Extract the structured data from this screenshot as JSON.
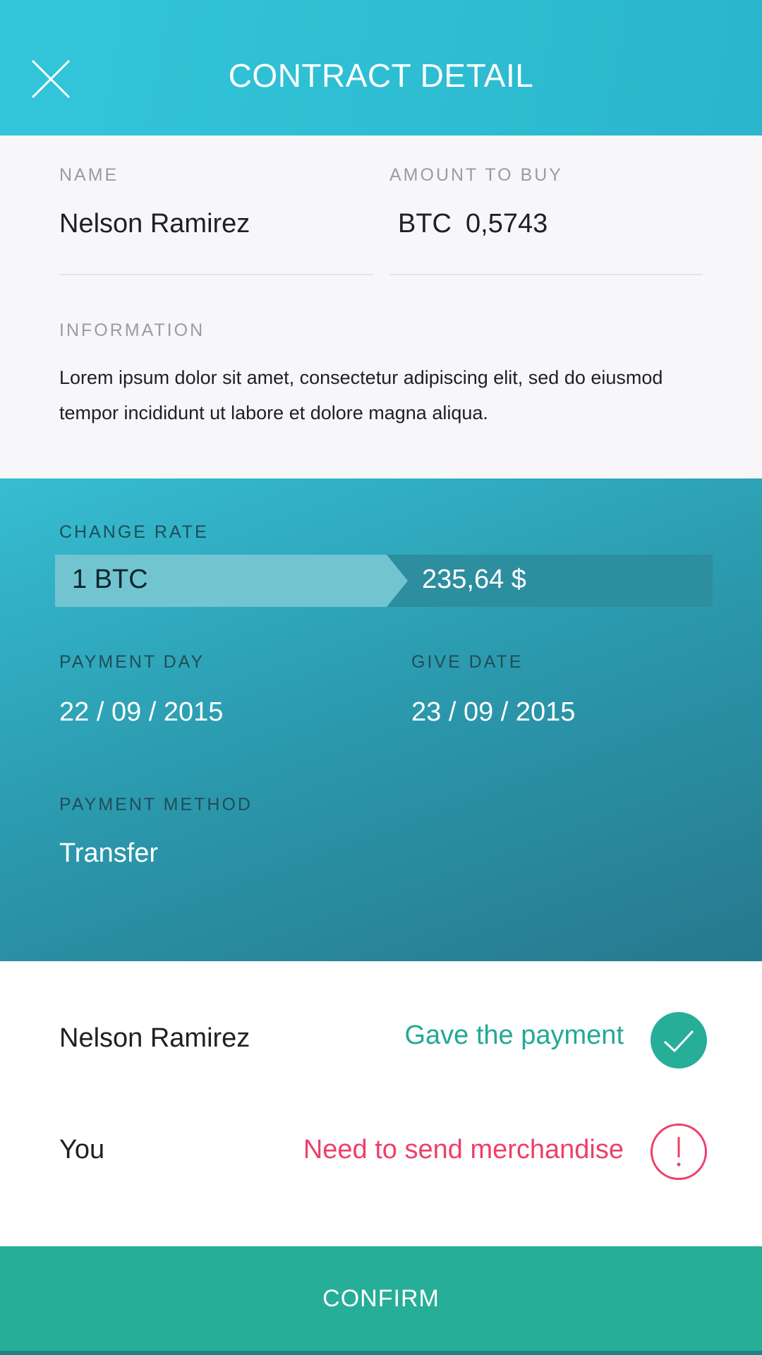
{
  "header": {
    "title": "CONTRACT DETAIL",
    "close_icon": "close-icon"
  },
  "details": {
    "name_label": "NAME",
    "name_value": "Nelson Ramirez",
    "amount_label": "AMOUNT TO BUY",
    "amount_currency": "BTC",
    "amount_value": "0,5743",
    "info_label": "INFORMATION",
    "info_text": "Lorem ipsum dolor sit amet, consectetur adipiscing elit, sed do eiusmod tempor incididunt ut labore et dolore magna aliqua."
  },
  "rates": {
    "change_rate_label": "CHANGE RATE",
    "rate_from": "1 BTC",
    "rate_to": "235,64 $",
    "payment_day_label": "PAYMENT DAY",
    "payment_day_value": "22 / 09 / 2015",
    "give_date_label": "GIVE DATE",
    "give_date_value": "23 / 09 / 2015",
    "payment_method_label": "PAYMENT METHOD",
    "payment_method_value": "Transfer"
  },
  "status": {
    "rows": [
      {
        "party": "Nelson Ramirez",
        "text": "Gave the payment",
        "icon": "check-icon",
        "color": "#22a994"
      },
      {
        "party": "You",
        "text": "Need to send merchandise",
        "icon": "alert-icon",
        "color": "#ee3f6b"
      }
    ]
  },
  "footer": {
    "confirm_label": "CONFIRM"
  },
  "colors": {
    "header": "#33c6da",
    "accent_green": "#26ae98",
    "warning_pink": "#ee3f6b",
    "rates_gradient_start": "#36bdd2",
    "rates_gradient_end": "#27788e"
  }
}
